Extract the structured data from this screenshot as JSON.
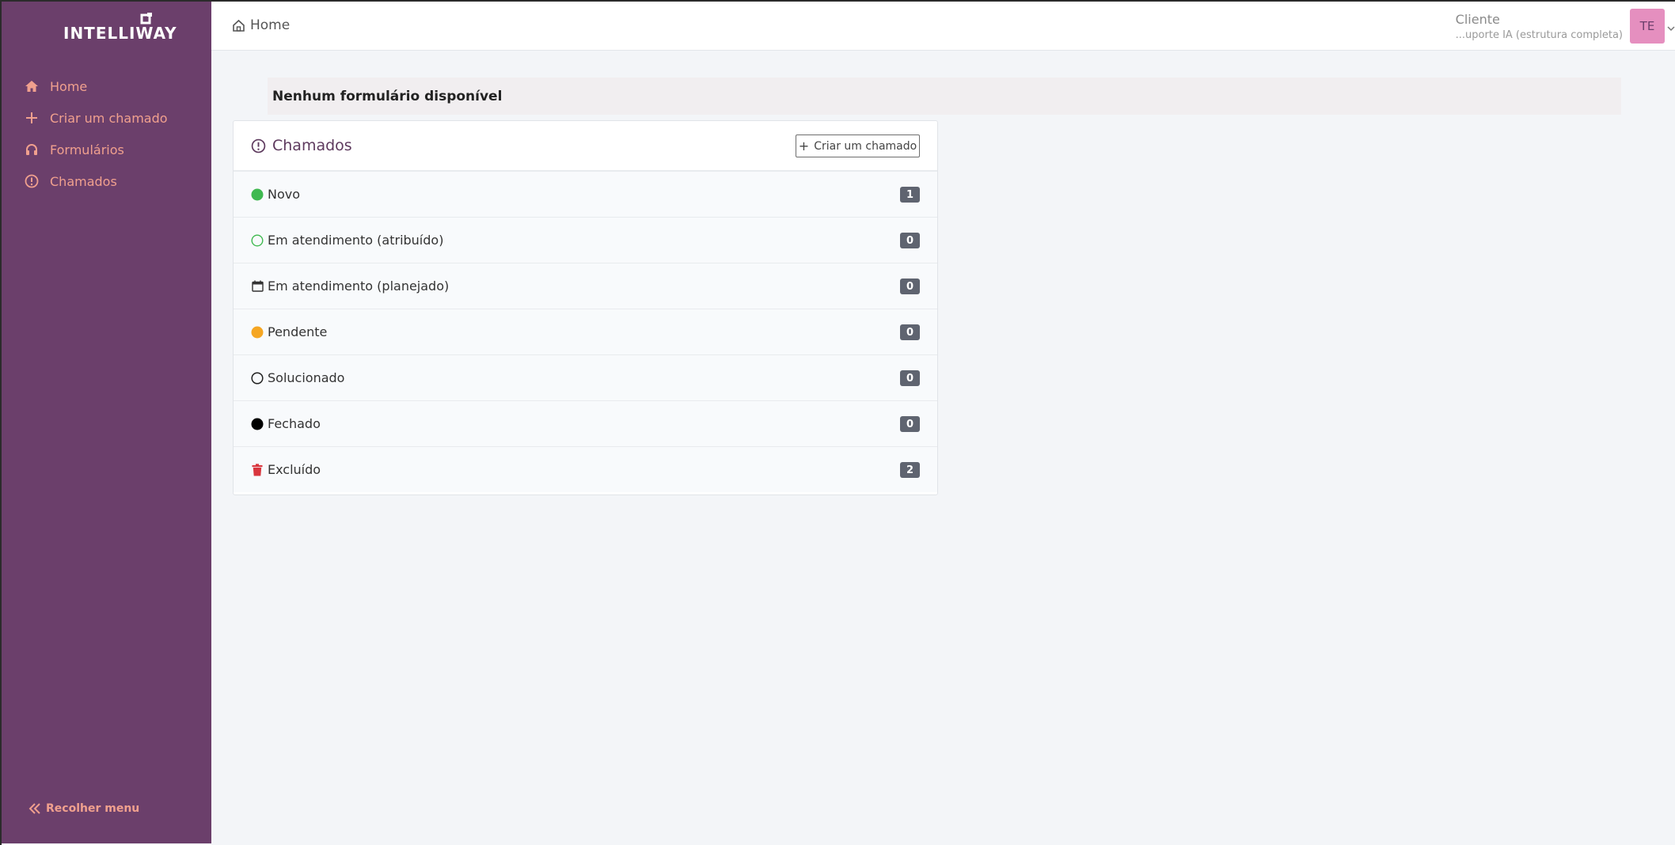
{
  "sidebar": {
    "logo_text": "INTELLIWAY",
    "items": [
      {
        "label": "Home",
        "icon": "home-icon"
      },
      {
        "label": "Criar um chamado",
        "icon": "plus-icon"
      },
      {
        "label": "Formulários",
        "icon": "headset-icon"
      },
      {
        "label": "Chamados",
        "icon": "alert-circle-icon"
      }
    ],
    "collapse_label": "Recolher menu",
    "colors": {
      "background": "#6b3f6b",
      "link": "#f0a08e"
    }
  },
  "topbar": {
    "breadcrumb": "Home",
    "user_role": "Cliente",
    "user_entity": "...uporte IA (estrutura completa)",
    "avatar_initials": "TE"
  },
  "notice": {
    "text": "Nenhum formulário disponível"
  },
  "tickets_card": {
    "title": "Chamados",
    "new_button_label": "Criar um chamado",
    "statuses": [
      {
        "label": "Novo",
        "count": "1",
        "icon": "green-filled-circle-icon",
        "color": "#3fb950"
      },
      {
        "label": "Em atendimento (atribuído)",
        "count": "0",
        "icon": "green-outline-circle-icon",
        "color": "#3fb950"
      },
      {
        "label": "Em atendimento (planejado)",
        "count": "0",
        "icon": "calendar-icon",
        "color": "#333333"
      },
      {
        "label": "Pendente",
        "count": "0",
        "icon": "orange-filled-circle-icon",
        "color": "#f5a623"
      },
      {
        "label": "Solucionado",
        "count": "0",
        "icon": "outline-circle-icon",
        "color": "#333333"
      },
      {
        "label": "Fechado",
        "count": "0",
        "icon": "black-filled-circle-icon",
        "color": "#000000"
      },
      {
        "label": "Excluído",
        "count": "2",
        "icon": "trash-icon",
        "color": "#d9363e"
      }
    ]
  }
}
